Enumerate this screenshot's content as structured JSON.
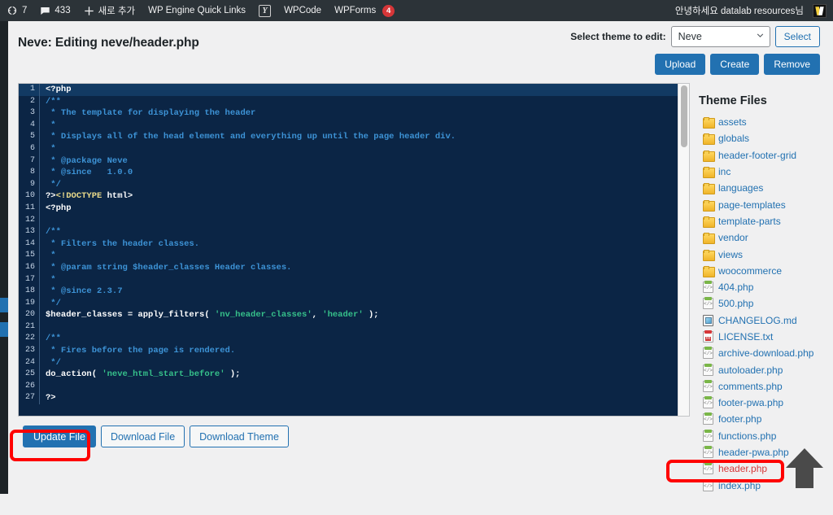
{
  "adminbar": {
    "items": [
      {
        "name": "updates",
        "icon": "updates-icon",
        "label": "7"
      },
      {
        "name": "comments",
        "icon": "comment-bubble-icon",
        "label": "433"
      },
      {
        "name": "new-content",
        "icon": "plus-icon",
        "label": "새로 추가"
      },
      {
        "name": "wp-engine",
        "icon": null,
        "label": "WP Engine Quick Links"
      },
      {
        "name": "yoast",
        "icon": "yoast-icon",
        "label": ""
      },
      {
        "name": "wpcode",
        "icon": null,
        "label": "WPCode"
      },
      {
        "name": "wpforms",
        "icon": null,
        "label": "WPForms",
        "badge": "4"
      }
    ],
    "account_greeting": "안녕하세요 datalab resources님",
    "avatar_icon": "avatar-icon"
  },
  "header": {
    "page_title": "Neve: Editing neve/header.php",
    "theme_picker_label": "Select theme to edit:",
    "theme_selected": "Neve",
    "theme_options": [
      "Neve"
    ],
    "select_button": "Select",
    "actions": [
      "Upload",
      "Create",
      "Remove"
    ]
  },
  "editor": {
    "lines": [
      {
        "n": "1",
        "tokens": [
          {
            "t": "<?php",
            "c": "tok-kw"
          }
        ],
        "active": true
      },
      {
        "n": "2",
        "tokens": [
          {
            "t": "/**",
            "c": "tok-com"
          }
        ]
      },
      {
        "n": "3",
        "tokens": [
          {
            "t": " * The template for displaying the header",
            "c": "tok-com"
          }
        ]
      },
      {
        "n": "4",
        "tokens": [
          {
            "t": " *",
            "c": "tok-com"
          }
        ]
      },
      {
        "n": "5",
        "tokens": [
          {
            "t": " * Displays all of the head element and everything up until the page header div.",
            "c": "tok-com"
          }
        ]
      },
      {
        "n": "6",
        "tokens": [
          {
            "t": " *",
            "c": "tok-com"
          }
        ]
      },
      {
        "n": "7",
        "tokens": [
          {
            "t": " * @package Neve",
            "c": "tok-com"
          }
        ]
      },
      {
        "n": "8",
        "tokens": [
          {
            "t": " * @since   1.0.0",
            "c": "tok-com"
          }
        ]
      },
      {
        "n": "9",
        "tokens": [
          {
            "t": " */",
            "c": "tok-com"
          }
        ]
      },
      {
        "n": "10",
        "tokens": [
          {
            "t": "?>",
            "c": "tok-kw"
          },
          {
            "t": "<!DOCTYPE",
            "c": "tok-dt"
          },
          {
            "t": " html>",
            "c": "tok-tag"
          }
        ]
      },
      {
        "n": "11",
        "tokens": [
          {
            "t": "<?php",
            "c": "tok-kw"
          }
        ]
      },
      {
        "n": "12",
        "tokens": [
          {
            "t": "",
            "c": "tok-pl"
          }
        ]
      },
      {
        "n": "13",
        "tokens": [
          {
            "t": "/**",
            "c": "tok-com"
          }
        ]
      },
      {
        "n": "14",
        "tokens": [
          {
            "t": " * Filters the header classes.",
            "c": "tok-com"
          }
        ]
      },
      {
        "n": "15",
        "tokens": [
          {
            "t": " *",
            "c": "tok-com"
          }
        ]
      },
      {
        "n": "16",
        "tokens": [
          {
            "t": " * @param string $header_classes Header classes.",
            "c": "tok-com"
          }
        ]
      },
      {
        "n": "17",
        "tokens": [
          {
            "t": " *",
            "c": "tok-com"
          }
        ]
      },
      {
        "n": "18",
        "tokens": [
          {
            "t": " * @since 2.3.7",
            "c": "tok-com"
          }
        ]
      },
      {
        "n": "19",
        "tokens": [
          {
            "t": " */",
            "c": "tok-com"
          }
        ]
      },
      {
        "n": "20",
        "tokens": [
          {
            "t": "$header_classes = apply_filters( ",
            "c": "tok-var"
          },
          {
            "t": "'nv_header_classes'",
            "c": "tok-str"
          },
          {
            "t": ", ",
            "c": "tok-pl"
          },
          {
            "t": "'header'",
            "c": "tok-str"
          },
          {
            "t": " );",
            "c": "tok-pl"
          }
        ]
      },
      {
        "n": "21",
        "tokens": [
          {
            "t": "",
            "c": "tok-pl"
          }
        ]
      },
      {
        "n": "22",
        "tokens": [
          {
            "t": "/**",
            "c": "tok-com"
          }
        ]
      },
      {
        "n": "23",
        "tokens": [
          {
            "t": " * Fires before the page is rendered.",
            "c": "tok-com"
          }
        ]
      },
      {
        "n": "24",
        "tokens": [
          {
            "t": " */",
            "c": "tok-com"
          }
        ]
      },
      {
        "n": "25",
        "tokens": [
          {
            "t": "do_action( ",
            "c": "tok-fn"
          },
          {
            "t": "'neve_html_start_before'",
            "c": "tok-str"
          },
          {
            "t": " );",
            "c": "tok-pl"
          }
        ]
      },
      {
        "n": "26",
        "tokens": [
          {
            "t": "",
            "c": "tok-pl"
          }
        ]
      },
      {
        "n": "27",
        "tokens": [
          {
            "t": "?>",
            "c": "tok-kw"
          }
        ]
      }
    ]
  },
  "bottom_actions": {
    "update_file": "Update File",
    "download_file": "Download File",
    "download_theme": "Download Theme"
  },
  "theme_files": {
    "title": "Theme Files",
    "items": [
      {
        "label": "assets",
        "kind": "folder"
      },
      {
        "label": "globals",
        "kind": "folder"
      },
      {
        "label": "header-footer-grid",
        "kind": "folder"
      },
      {
        "label": "inc",
        "kind": "folder"
      },
      {
        "label": "languages",
        "kind": "folder"
      },
      {
        "label": "page-templates",
        "kind": "folder"
      },
      {
        "label": "template-parts",
        "kind": "folder"
      },
      {
        "label": "vendor",
        "kind": "folder"
      },
      {
        "label": "views",
        "kind": "folder"
      },
      {
        "label": "woocommerce",
        "kind": "folder"
      },
      {
        "label": "404.php",
        "kind": "php"
      },
      {
        "label": "500.php",
        "kind": "php"
      },
      {
        "label": "CHANGELOG.md",
        "kind": "md"
      },
      {
        "label": "LICENSE.txt",
        "kind": "txt"
      },
      {
        "label": "archive-download.php",
        "kind": "php"
      },
      {
        "label": "autoloader.php",
        "kind": "php"
      },
      {
        "label": "comments.php",
        "kind": "php"
      },
      {
        "label": "footer-pwa.php",
        "kind": "php"
      },
      {
        "label": "footer.php",
        "kind": "php"
      },
      {
        "label": "functions.php",
        "kind": "php"
      },
      {
        "label": "header-pwa.php",
        "kind": "php"
      },
      {
        "label": "header.php",
        "kind": "php",
        "current": true
      },
      {
        "label": "index.php",
        "kind": "php"
      }
    ]
  },
  "annotations": {
    "highlight_color": "#ff0000",
    "arrow_color": "#4a4a4a",
    "boxed": [
      "Update File",
      "header.php"
    ]
  }
}
